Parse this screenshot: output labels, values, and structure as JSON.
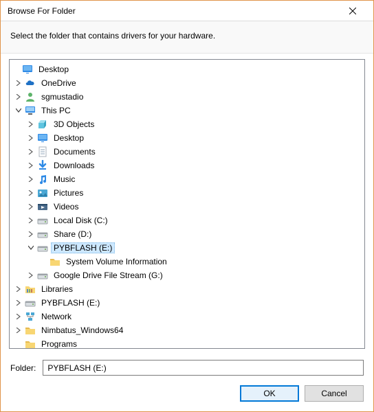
{
  "title": "Browse For Folder",
  "instruction": "Select the folder that contains drivers for your hardware.",
  "folder_label": "Folder:",
  "folder_value": "PYBFLASH (E:)",
  "ok_label": "OK",
  "cancel_label": "Cancel",
  "tree": {
    "desktop": "Desktop",
    "onedrive": "OneDrive",
    "user": "sgmustadio",
    "thispc": "This PC",
    "objects3d": "3D Objects",
    "desktop2": "Desktop",
    "documents": "Documents",
    "downloads": "Downloads",
    "music": "Music",
    "pictures": "Pictures",
    "videos": "Videos",
    "localdisk": "Local Disk (C:)",
    "share": "Share (D:)",
    "pybflash": "PYBFLASH (E:)",
    "sysvol": "System Volume Information",
    "gdrive": "Google Drive File Stream (G:)",
    "libraries": "Libraries",
    "pybflash2": "PYBFLASH (E:)",
    "network": "Network",
    "nimbatus": "Nimbatus_Windows64",
    "programs": "Programs"
  }
}
